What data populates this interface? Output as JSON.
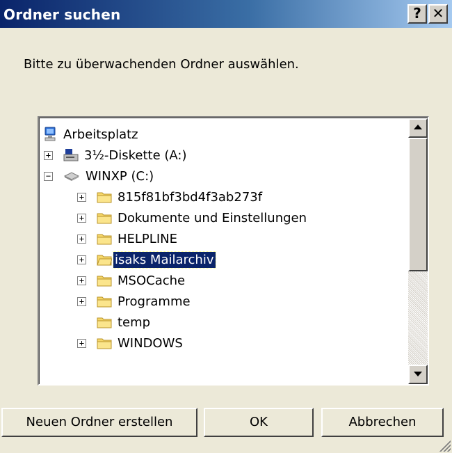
{
  "window": {
    "title": "Ordner suchen",
    "help_label": "?",
    "close_label": "✕"
  },
  "prompt": "Bitte zu überwachenden Ordner auswählen.",
  "tree": {
    "items": [
      {
        "label": "Arbeitsplatz",
        "icon": "computer-icon",
        "expander": ""
      },
      {
        "label": "3½-Diskette (A:)",
        "icon": "floppy-drive-icon",
        "expander": "+"
      },
      {
        "label": "WINXP (C:)",
        "icon": "hard-drive-icon",
        "expander": "−"
      },
      {
        "label": "815f81bf3bd4f3ab273f",
        "icon": "folder-icon",
        "expander": "+"
      },
      {
        "label": "Dokumente und Einstellungen",
        "icon": "folder-icon",
        "expander": "+"
      },
      {
        "label": "HELPLINE",
        "icon": "folder-icon",
        "expander": "+"
      },
      {
        "label": "isaks Mailarchiv",
        "icon": "folder-icon",
        "expander": "+",
        "selected": true
      },
      {
        "label": "MSOCache",
        "icon": "folder-icon",
        "expander": "+"
      },
      {
        "label": "Programme",
        "icon": "folder-icon",
        "expander": "+"
      },
      {
        "label": "temp",
        "icon": "folder-icon",
        "expander": ""
      },
      {
        "label": "WINDOWS",
        "icon": "folder-icon",
        "expander": "+"
      }
    ]
  },
  "buttons": {
    "new_folder": "Neuen Ordner erstellen",
    "ok": "OK",
    "cancel": "Abbrechen"
  },
  "colors": {
    "titlebar_start": "#0a246a",
    "titlebar_end": "#a6caf0",
    "selection": "#0a246a",
    "dialog_bg": "#ece9d8"
  }
}
